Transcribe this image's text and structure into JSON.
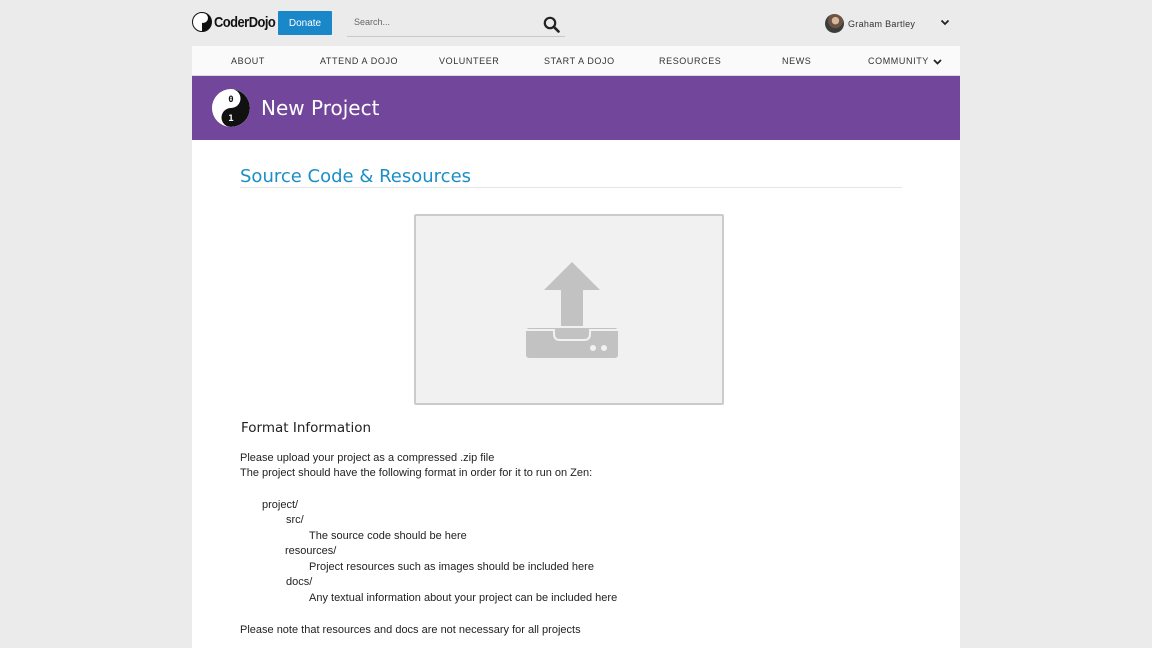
{
  "header": {
    "logo_text": "CoderDojo",
    "donate_label": "Donate",
    "search_placeholder": "Search...",
    "user_name": "Graham Bartley",
    "icons": {
      "search": "search-icon",
      "user_menu": "chevron-down-icon",
      "avatar": "avatar"
    }
  },
  "nav": {
    "items": [
      {
        "label": "ABOUT"
      },
      {
        "label": "ATTEND A DOJO"
      },
      {
        "label": "VOLUNTEER"
      },
      {
        "label": "START A DOJO"
      },
      {
        "label": "RESOURCES"
      },
      {
        "label": "NEWS"
      },
      {
        "label": "COMMUNITY"
      }
    ]
  },
  "hero": {
    "title": "New Project",
    "logo_glyphs": [
      "0",
      "1"
    ],
    "background_color": "#72469b"
  },
  "main": {
    "section_title": "Source Code & Resources",
    "upload_icon": "upload-icon",
    "format_heading": "Format Information",
    "lines": {
      "upload_zip": "Please upload your project as a compressed .zip file",
      "format_intro": "The project should have the following format in order for it to run on Zen:",
      "tree_project": "project/",
      "tree_src": "src/",
      "tree_src_desc": "The source code should be here",
      "tree_resources": "resources/",
      "tree_resources_desc": "Project resources such as images should be included here",
      "tree_docs": "docs/",
      "tree_docs_desc": "Any textual information about your project can be included here",
      "note": "Please note that resources and docs are not necessary for all projects"
    }
  },
  "colors": {
    "accent_blue": "#1a87c8",
    "title_blue": "#1b8ec8",
    "purple": "#72469b"
  }
}
